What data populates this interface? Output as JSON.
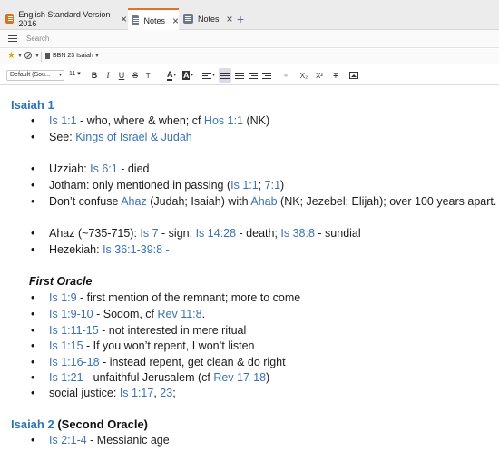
{
  "tabs": [
    {
      "label": "English Standard Version 2016",
      "active": false,
      "icon": "bible-icon"
    },
    {
      "label": "Notes",
      "active": true,
      "icon": "notes-icon"
    },
    {
      "label": "Notes",
      "active": false,
      "icon": "notes-icon"
    }
  ],
  "search": {
    "placeholder": "Search"
  },
  "subbar": {
    "notebook": "BBN 23 Isaiah"
  },
  "format": {
    "font": "Default (Sou...",
    "size": "11",
    "accent": "#2e75b6"
  },
  "colors": {
    "link": "#3a73b3",
    "heading": "#2e75b6",
    "active_tab": "#e8711f"
  },
  "doc": {
    "h1": "Isaiah 1",
    "b1": {
      "ref": "Is 1:1",
      "t1": " - who, where & when; cf ",
      "ref2": "Hos 1:1",
      "t2": " (NK)"
    },
    "b2": {
      "t1": "See: ",
      "ref": "Kings of Israel & Judah"
    },
    "b3": {
      "t1": "Uzziah: ",
      "ref": "Is 6:1",
      "t2": " - died"
    },
    "b4": {
      "t1": "Jotham: only mentioned in passing (",
      "ref": "Is 1:1",
      "t2": "; ",
      "ref2": "7:1",
      "t3": ")"
    },
    "b5": {
      "t1": "Don’t confuse ",
      "ref": "Ahaz",
      "t2": " (Judah; Isaiah) with ",
      "ref2": "Ahab",
      "t3": " (NK; Jezebel; Elijah); over 100 years apart."
    },
    "b6": {
      "t1": "Ahaz (~735-715): ",
      "ref": "Is 7",
      "t2": " - sign; ",
      "ref2": "Is 14:28",
      "t3": " - death; ",
      "ref3": "Is 38:8",
      "t4": " - sundial"
    },
    "b7": {
      "t1": "Hezekiah: ",
      "ref": "Is 36:1-39:8",
      "t2": " -"
    },
    "sub1": "First Oracle",
    "c1": {
      "ref": "Is 1:9",
      "t1": " - first mention of the remnant; more to come"
    },
    "c2": {
      "ref": "Is 1:9-10",
      "t1": " - Sodom, cf ",
      "ref2": "Rev 11:8",
      "t2": "."
    },
    "c3": {
      "ref": "Is 1:11-15",
      "t1": " - not interested in mere ritual"
    },
    "c4": {
      "ref": "Is 1:15",
      "t1": " - If you won’t repent, I won’t listen"
    },
    "c5": {
      "ref": "Is 1:16-18",
      "t1": " - instead repent, get clean & do right"
    },
    "c6": {
      "ref": "Is 1:21",
      "t1": " - unfaithful Jerusalem (cf ",
      "ref2": "Rev 17-18",
      "t2": ")"
    },
    "c7": {
      "t1": "social justice: ",
      "ref": "Is 1:17",
      "t2": ", ",
      "ref2": "23",
      "t3": ";"
    },
    "h2": "Isaiah 2",
    "h2_plain": " (Second Oracle)",
    "d1": {
      "ref": "Is 2:1-4",
      "t1": " - Messianic age"
    }
  }
}
